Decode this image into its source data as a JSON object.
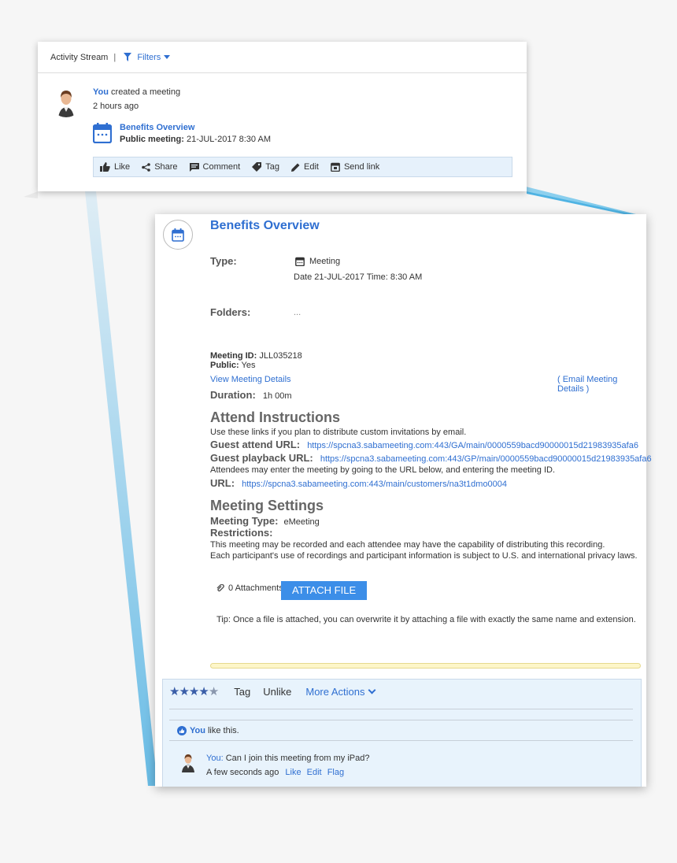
{
  "activity": {
    "header": {
      "title": "Activity Stream",
      "separator": "|",
      "filters": "Filters"
    },
    "post": {
      "actor": "You",
      "action": "created a meeting",
      "time": "2 hours ago"
    },
    "event": {
      "title": "Benefits Overview",
      "sub_label": "Public meeting:",
      "sub_value": "21-JUL-2017 8:30 AM"
    },
    "actions": [
      "Like",
      "Share",
      "Comment",
      "Tag",
      "Edit",
      "Send link"
    ]
  },
  "detail": {
    "title": "Benefits Overview",
    "type_label": "Type:",
    "type_value": "Meeting",
    "date_line": "Date 21-JUL-2017 Time: 8:30 AM",
    "folders_label": "Folders:",
    "folders_value": "...",
    "meeting_id_label": "Meeting ID:",
    "meeting_id_value": "JLL035218",
    "public_label": "Public:",
    "public_value": "Yes",
    "view_details": "View Meeting Details",
    "email_details": "( Email Meeting Details )",
    "duration_label": "Duration:",
    "duration_value": "1h 00m",
    "attend_heading": "Attend Instructions",
    "attend_intro": "Use these links if you plan to distribute custom invitations by email.",
    "guest_attend_label": "Guest attend URL:",
    "guest_attend_url": "https://spcna3.sabameeting.com:443/GA/main/0000559bacd90000015d21983935afa6",
    "guest_playback_label": "Guest playback URL:",
    "guest_playback_url": "https://spcna3.sabameeting.com:443/GP/main/0000559bacd90000015d21983935afa6",
    "attendee_note": "Attendees may enter the meeting by going to the URL below, and entering the meeting ID.",
    "url_label": "URL:",
    "url_value": "https://spcna3.sabameeting.com:443/main/customers/na3t1dmo0004",
    "settings_heading": "Meeting Settings",
    "meeting_type_label": "Meeting Type:",
    "meeting_type_value": "eMeeting",
    "restrictions_label": "Restrictions:",
    "restriction_1": "This meeting may be recorded and each attendee may have the capability of distributing this recording.",
    "restriction_2": "Each participant's use of recordings and participant information is subject to U.S. and international privacy laws.",
    "attachments": "0 Attachments",
    "attach_button": "ATTACH FILE",
    "tip": "Tip: Once a file is attached, you can overwrite it by attaching a file with exactly the same name and extension."
  },
  "social": {
    "rating": 4,
    "rating_max": 5,
    "tag": "Tag",
    "unlike": "Unlike",
    "more_actions": "More Actions",
    "like_actor": "You",
    "like_text": "like this.",
    "comment_author": "You:",
    "comment_text": "Can I join this meeting from my iPad?",
    "comment_time": "A few seconds ago",
    "comment_actions": [
      "Like",
      "Edit",
      "Flag"
    ]
  },
  "colors": {
    "accent": "#2f6fd1",
    "button": "#3c8ee8",
    "bar_bg": "#e6f1fb"
  }
}
